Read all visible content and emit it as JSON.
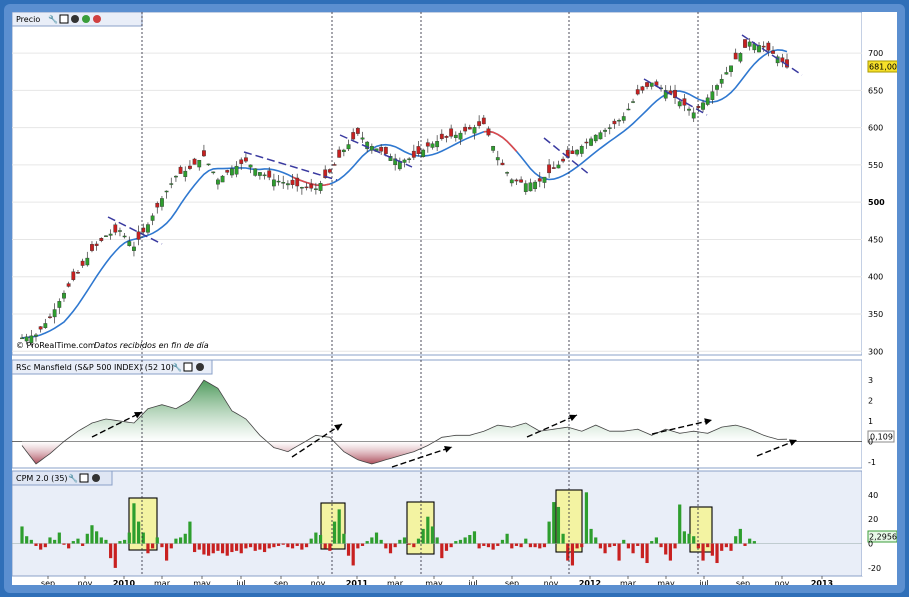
{
  "panels": {
    "price": {
      "title": "Precio",
      "watermark": "© ProRealTime.com",
      "watermark_note": "Datos recibidos en fin de día",
      "last_value_label": "681,000",
      "yticks": [
        "700",
        "650",
        "600",
        "550",
        "500",
        "450",
        "400",
        "350",
        "300"
      ]
    },
    "rsc": {
      "title": "RSc Mansfield (S&P 500 INDEX) (52 10)",
      "last_value_label": "0,109",
      "yticks": [
        "3",
        "2",
        "1",
        "0",
        "-1"
      ]
    },
    "cpm": {
      "title": "CPM 2.0 (35)",
      "last_value_label": "2,2956",
      "yticks": [
        "40",
        "20",
        "0",
        "-20"
      ]
    }
  },
  "xaxis": {
    "labels": [
      "sep",
      "nov",
      "2010",
      "mar",
      "may",
      "jul",
      "sep",
      "nov",
      "2011",
      "mar",
      "may",
      "jul",
      "sep",
      "nov",
      "2012",
      "mar",
      "may",
      "jul",
      "sep",
      "nov",
      "2013"
    ]
  },
  "colors": {
    "up": "#2e9e2e",
    "down": "#c82020",
    "ma": "#2f78d0",
    "ma_weak": "#e04a4a",
    "rsc_pos": "#3b8f4a",
    "rsc_neg": "#a33a4a",
    "highlight": "#f3f3a2",
    "trend_dash": "#3a3aa0"
  },
  "chart_data": [
    {
      "type": "candlestick",
      "title": "Precio",
      "ylim": [
        295,
        735
      ],
      "series": [
        {
          "name": "Precio",
          "close_path": [
            [
              0,
              318
            ],
            [
              3,
              322
            ],
            [
              6,
              345
            ],
            [
              9,
              378
            ],
            [
              12,
              405
            ],
            [
              15,
              435
            ],
            [
              18,
              455
            ],
            [
              21,
              462
            ],
            [
              24,
              440
            ],
            [
              27,
              470
            ],
            [
              30,
              505
            ],
            [
              33,
              535
            ],
            [
              36,
              545
            ],
            [
              39,
              562
            ],
            [
              42,
              530
            ],
            [
              45,
              545
            ],
            [
              48,
              555
            ],
            [
              51,
              540
            ],
            [
              54,
              530
            ],
            [
              57,
              525
            ],
            [
              60,
              520
            ],
            [
              63,
              518
            ],
            [
              66,
              540
            ],
            [
              69,
              570
            ],
            [
              72,
              592
            ],
            [
              75,
              575
            ],
            [
              78,
              565
            ],
            [
              81,
              555
            ],
            [
              84,
              560
            ],
            [
              87,
              575
            ],
            [
              90,
              585
            ],
            [
              93,
              590
            ],
            [
              96,
              598
            ],
            [
              99,
              605
            ],
            [
              102,
              560
            ],
            [
              105,
              530
            ],
            [
              108,
              525
            ],
            [
              111,
              528
            ],
            [
              114,
              545
            ],
            [
              117,
              560
            ],
            [
              120,
              575
            ],
            [
              123,
              590
            ],
            [
              126,
              600
            ],
            [
              129,
              615
            ],
            [
              132,
              645
            ],
            [
              135,
              660
            ],
            [
              138,
              650
            ],
            [
              141,
              635
            ],
            [
              144,
              620
            ],
            [
              147,
              640
            ],
            [
              150,
              665
            ],
            [
              153,
              692
            ],
            [
              156,
              715
            ],
            [
              159,
              708
            ],
            [
              162,
              695
            ],
            [
              164,
              681
            ]
          ]
        }
      ]
    },
    {
      "type": "area",
      "title": "RSc Mansfield (S&P 500 INDEX) (52 10)",
      "ylim": [
        -1.3,
        3.3
      ],
      "series": [
        {
          "name": "RSc Mansfield",
          "values": [
            [
              0,
              -0.2
            ],
            [
              3,
              -1.1
            ],
            [
              6,
              -0.6
            ],
            [
              9,
              0.0
            ],
            [
              12,
              0.5
            ],
            [
              15,
              0.9
            ],
            [
              18,
              1.1
            ],
            [
              21,
              1.0
            ],
            [
              24,
              0.9
            ],
            [
              27,
              1.6
            ],
            [
              30,
              1.8
            ],
            [
              33,
              1.6
            ],
            [
              36,
              2.0
            ],
            [
              39,
              3.0
            ],
            [
              42,
              2.6
            ],
            [
              45,
              1.5
            ],
            [
              48,
              1.1
            ],
            [
              51,
              0.3
            ],
            [
              54,
              -0.3
            ],
            [
              57,
              -0.5
            ],
            [
              60,
              -0.1
            ],
            [
              63,
              0.3
            ],
            [
              66,
              0.2
            ],
            [
              69,
              -0.5
            ],
            [
              72,
              -0.9
            ],
            [
              75,
              -1.1
            ],
            [
              78,
              -0.9
            ],
            [
              81,
              -0.7
            ],
            [
              84,
              -0.5
            ],
            [
              87,
              -0.2
            ],
            [
              90,
              0.2
            ],
            [
              93,
              0.3
            ],
            [
              96,
              0.3
            ],
            [
              99,
              0.5
            ],
            [
              102,
              0.8
            ],
            [
              105,
              0.7
            ],
            [
              108,
              0.9
            ],
            [
              111,
              0.5
            ],
            [
              114,
              0.6
            ],
            [
              117,
              0.7
            ],
            [
              120,
              0.5
            ],
            [
              123,
              0.8
            ],
            [
              126,
              0.5
            ],
            [
              129,
              0.5
            ],
            [
              132,
              0.6
            ],
            [
              135,
              0.3
            ],
            [
              138,
              0.6
            ],
            [
              141,
              0.4
            ],
            [
              144,
              0.5
            ],
            [
              147,
              0.4
            ],
            [
              150,
              0.7
            ],
            [
              153,
              0.8
            ],
            [
              156,
              0.6
            ],
            [
              159,
              0.3
            ],
            [
              162,
              0.1
            ],
            [
              164,
              0.109
            ]
          ]
        }
      ]
    },
    {
      "type": "bar",
      "title": "CPM 2.0 (35)",
      "ylim": [
        -25,
        48
      ],
      "series": [
        {
          "name": "CPM 2.0",
          "values": [
            14,
            6,
            3,
            -2,
            -5,
            -3,
            5,
            3,
            9,
            -1,
            -4,
            2,
            4,
            -2,
            8,
            15,
            10,
            5,
            3,
            -12,
            -20,
            2,
            3,
            9,
            33,
            18,
            9,
            -8,
            -4,
            5,
            -3,
            -14,
            -4,
            4,
            5,
            8,
            18,
            -7,
            -5,
            -9,
            -10,
            -8,
            -6,
            -8,
            -10,
            -7,
            -6,
            -8,
            -4,
            -3,
            -6,
            -5,
            -7,
            -4,
            -3,
            -2,
            -1,
            -3,
            -4,
            -2,
            -5,
            -3,
            4,
            9,
            7,
            -4,
            -6,
            18,
            28,
            8,
            -10,
            -18,
            -4,
            -2,
            2,
            5,
            9,
            3,
            -4,
            -8,
            -3,
            3,
            5,
            -1,
            -3,
            4,
            12,
            22,
            14,
            5,
            -12,
            -6,
            -3,
            2,
            3,
            5,
            7,
            10,
            -4,
            -2,
            -3,
            -5,
            -2,
            3,
            8,
            -4,
            -2,
            -3,
            4,
            -3,
            -3,
            -4,
            -3,
            18,
            34,
            30,
            8,
            -14,
            -18,
            -4,
            -3,
            42,
            12,
            5,
            -4,
            -8,
            -3,
            -2,
            -14,
            3,
            -4,
            -8,
            -2,
            -12,
            -16,
            2,
            5,
            -3,
            -9,
            -14,
            -4,
            32,
            10,
            8,
            6,
            -4,
            -14,
            -3,
            -10,
            -16,
            -6,
            -3,
            -6,
            6,
            12,
            -2,
            4,
            2
          ]
        }
      ]
    }
  ]
}
